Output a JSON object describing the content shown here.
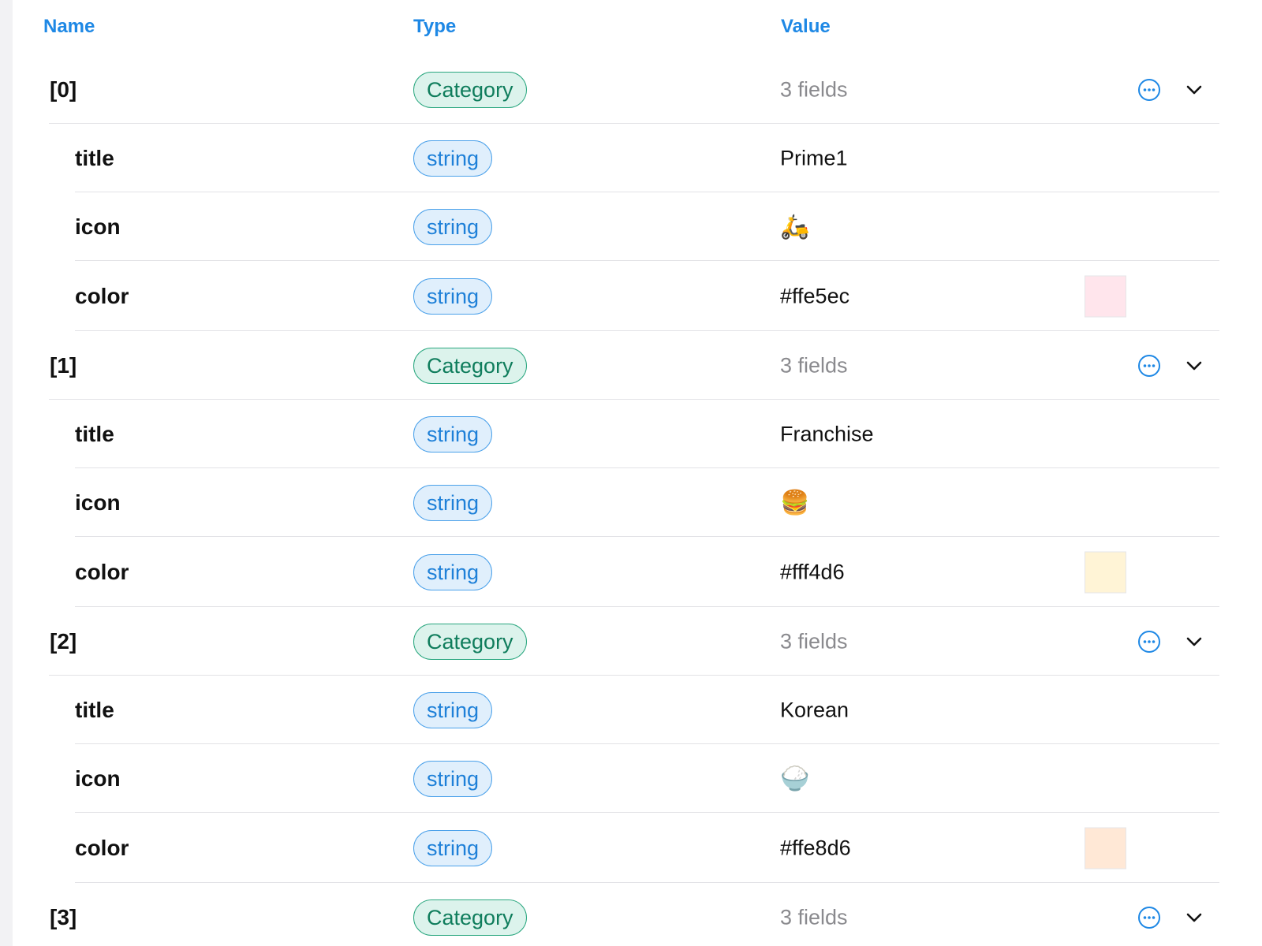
{
  "columns": {
    "name": "Name",
    "type": "Type",
    "value": "Value"
  },
  "items": [
    {
      "index": "[0]",
      "type": "Category",
      "summary": "3 fields",
      "fields": [
        {
          "name": "title",
          "type": "string",
          "value": "Prime1"
        },
        {
          "name": "icon",
          "type": "string",
          "value": "🛵"
        },
        {
          "name": "color",
          "type": "string",
          "value": "#ffe5ec",
          "swatch": "#ffe5ec"
        }
      ]
    },
    {
      "index": "[1]",
      "type": "Category",
      "summary": "3 fields",
      "fields": [
        {
          "name": "title",
          "type": "string",
          "value": "Franchise"
        },
        {
          "name": "icon",
          "type": "string",
          "value": "🍔"
        },
        {
          "name": "color",
          "type": "string",
          "value": "#fff4d6",
          "swatch": "#fff4d6"
        }
      ]
    },
    {
      "index": "[2]",
      "type": "Category",
      "summary": "3 fields",
      "fields": [
        {
          "name": "title",
          "type": "string",
          "value": "Korean"
        },
        {
          "name": "icon",
          "type": "string",
          "value": "🍚"
        },
        {
          "name": "color",
          "type": "string",
          "value": "#ffe8d6",
          "swatch": "#ffe8d6"
        }
      ]
    },
    {
      "index": "[3]",
      "type": "Category",
      "summary": "3 fields",
      "fields": []
    }
  ],
  "icons": {
    "more": "more-options-icon",
    "expand": "chevron-down-icon"
  },
  "colors": {
    "accent": "#1e88e5",
    "category_green": "#0f7d5c",
    "string_blue": "#1e80d8"
  }
}
